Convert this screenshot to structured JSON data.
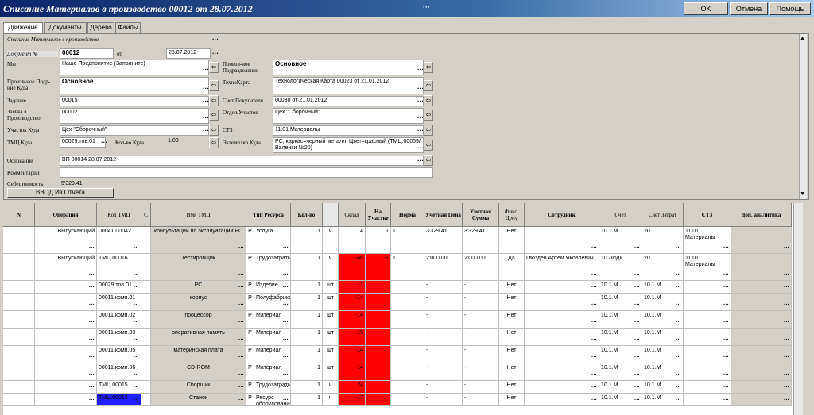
{
  "window": {
    "title": "Списание Материалов в производство 00012 от 28.07.2012",
    "ok": "OK",
    "cancel": "Отмена",
    "help": "Помощь"
  },
  "tabs": [
    "Движение",
    "Документы",
    "Дерево",
    "Файлы"
  ],
  "form": {
    "caption": "Списание Материалов в производство",
    "doc_num_label": "Документ №",
    "doc_num": "00012",
    "date_label": "от",
    "date": "28.07.2012",
    "we_label": "Мы",
    "we": "Наше Предприятие (Заполните)",
    "prod_label": "Произв-ное Подразделение",
    "prod": "Основное",
    "proddest_label": "Произв-ное Подр-ние Куда",
    "proddest": "Основное",
    "techcard_label": "ТехноКарта",
    "techcard": "Технологическая Карта 00023 от 21.01.2012",
    "task_label": "Задание",
    "task": "00015",
    "invoice_label": "Счет Покупателя",
    "invoice": "00030 от 21.01.2012",
    "request_label": "Заявка в Производство",
    "request": "00002",
    "dept_label": "Отдел/Участок",
    "dept": "Цех \"Сборочный\"",
    "section_label": "Участок Куда",
    "section": "Цех \"Сборочный\"",
    "stz_label": "СТЗ",
    "stz": "11.01 Материалы",
    "tmc_label": "ТМЦ Куда",
    "tmc": "00029.тов.01",
    "qty_label": "Кол-во Куда",
    "qty": "1.00",
    "instance_label": "Экземпляр Куда",
    "instance": "PC, каркас=черный металл, Цвет=красный (ТМЦ.00059/Валенки №20)",
    "basis_label": "Основание",
    "basis": "ВП 00014 28.07.2012",
    "comment_label": "Комментарий",
    "comment": "",
    "cost_label": "Себестоимость",
    "cost": "5'329.41",
    "input_btn": "ВВОД Из Отчета"
  },
  "grid": {
    "headers": [
      "N",
      "Операция",
      "Код ТМЦ",
      "С",
      "Имя ТМЦ",
      "Тип Ресурса",
      "Кол-во",
      "Склад",
      "На Участке",
      "Норма",
      "Учетная Цена",
      "Учетная Сумма",
      "Фикс. Цену",
      "Сотрудник",
      "Счет",
      "Счет Затрат",
      "СТЗ",
      "Доп. аналитика"
    ],
    "rows": [
      {
        "op": "Выпускающий",
        "code": "00041.00042",
        "name": "консультации по эксплуатации PC",
        "p": "P",
        "type": "Услуга",
        "qty": "1",
        "unit": "ч",
        "stock": "14",
        "onsite": "1",
        "norm": "1",
        "price": "3'329.41",
        "sum": "3'329.41",
        "fix": "Нет",
        "emp": "",
        "acc": "10.1.M",
        "accexp": "20",
        "stz": "11.01 Материалы"
      },
      {
        "op": "Выпускающий",
        "code": "ТМЦ.00016",
        "name": "Тестировщик",
        "p": "P",
        "type": "Трудозатраты",
        "qty": "1",
        "unit": "ч",
        "stock": "-46",
        "onsite": "-1",
        "norm": "1",
        "price": "2'000.00",
        "sum": "2'000.00",
        "fix": "Да",
        "emp": "Гвоздев Артем Яковлевич",
        "acc": "10.Люди",
        "accexp": "20",
        "stz": "11.01 Материалы"
      },
      {
        "op": "",
        "code": "00029.тов.01",
        "name": "PC",
        "p": "P",
        "type": "Изделие",
        "qty": "1",
        "unit": "шт",
        "stock": "-1",
        "onsite": "",
        "norm": "",
        "price": "-",
        "sum": "-",
        "fix": "Нет",
        "emp": "",
        "acc": "10.1.M",
        "accexp": "10.1.M",
        "stz": ""
      },
      {
        "op": "",
        "code": "00011.комп.01",
        "name": "корпус",
        "p": "P",
        "type": "Полуфабрикат",
        "qty": "1",
        "unit": "шт",
        "stock": "-14",
        "onsite": "",
        "norm": "",
        "price": "-",
        "sum": "-",
        "fix": "Нет",
        "emp": "",
        "acc": "10.1.M",
        "accexp": "10.1.M",
        "stz": ""
      },
      {
        "op": "",
        "code": "00011.комп.02",
        "name": "процессор",
        "p": "P",
        "type": "Материал",
        "qty": "1",
        "unit": "шт",
        "stock": "-14",
        "onsite": "",
        "norm": "",
        "price": "-",
        "sum": "-",
        "fix": "Нет",
        "emp": "",
        "acc": "10.1.M",
        "accexp": "10.1.M",
        "stz": ""
      },
      {
        "op": "",
        "code": "00011.комп.03",
        "name": "оперативная память",
        "p": "P",
        "type": "Материал",
        "qty": "1",
        "unit": "шт",
        "stock": "-15",
        "onsite": "",
        "norm": "",
        "price": "-",
        "sum": "-",
        "fix": "Нет",
        "emp": "",
        "acc": "10.1.M",
        "accexp": "10.1.M",
        "stz": ""
      },
      {
        "op": "",
        "code": "00011.комп.05",
        "name": "материнская плата",
        "p": "P",
        "type": "Материал",
        "qty": "1",
        "unit": "шт",
        "stock": "-14",
        "onsite": "",
        "norm": "",
        "price": "-",
        "sum": "-",
        "fix": "Нет",
        "emp": "",
        "acc": "10.1.M",
        "accexp": "10.1.M",
        "stz": ""
      },
      {
        "op": "",
        "code": "00011.комп.06",
        "name": "CD-ROM",
        "p": "P",
        "type": "Материал",
        "qty": "1",
        "unit": "шт",
        "stock": "-14",
        "onsite": "",
        "norm": "",
        "price": "-",
        "sum": "-",
        "fix": "Нет",
        "emp": "",
        "acc": "10.1.M",
        "accexp": "10.1.M",
        "stz": ""
      },
      {
        "op": "",
        "code": "ТМЦ.00015",
        "name": "Сборщик",
        "p": "P",
        "type": "Трудозатраты",
        "qty": "1",
        "unit": "ч",
        "stock": "24",
        "onsite": "",
        "norm": "",
        "price": "-",
        "sum": "-",
        "fix": "Нет",
        "emp": "",
        "acc": "10.1.M",
        "accexp": "10.1.M",
        "stz": ""
      },
      {
        "op": "",
        "code": "ТМЦ.00014",
        "name": "Станок",
        "p": "P",
        "type": "Ресурс оборудования",
        "qty": "1",
        "unit": "ч",
        "stock": "-17",
        "onsite": "",
        "norm": "",
        "price": "-",
        "sum": "-",
        "fix": "Нет",
        "emp": "",
        "acc": "10.1.M",
        "accexp": "10.1.M",
        "stz": ""
      }
    ]
  }
}
